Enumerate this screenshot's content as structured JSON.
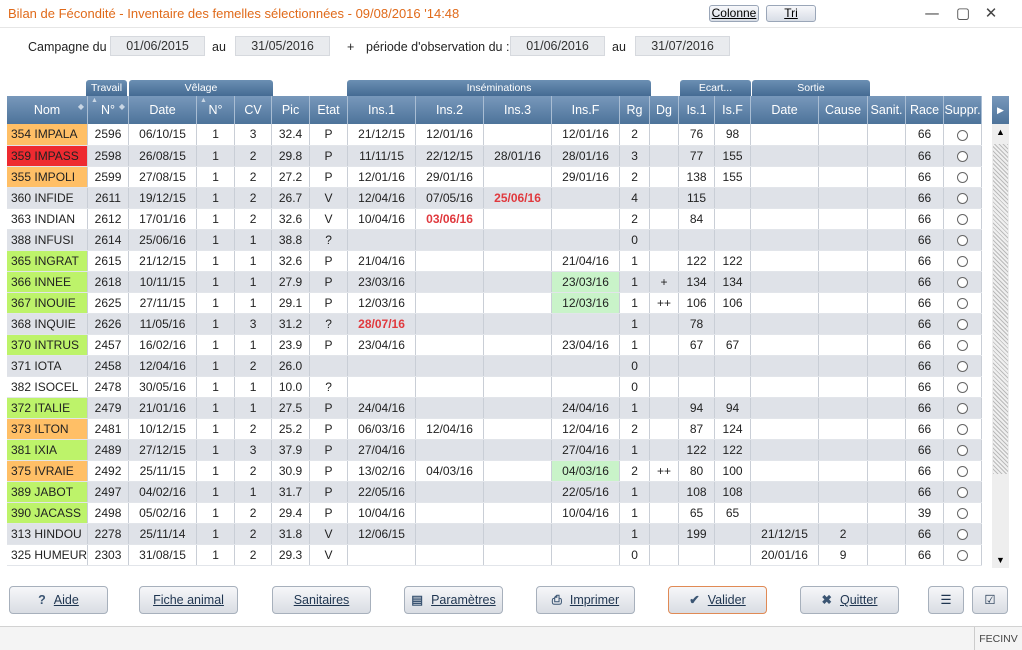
{
  "window": {
    "title": "Bilan de Fécondité - Inventaire des femelles sélectionnées - 09/08/2016 '14:48",
    "colonne_label": "Colonne",
    "tri_label": "Tri"
  },
  "campaign": {
    "label_from": "Campagne du",
    "date_from": "01/06/2015",
    "label_to": "au",
    "date_to": "31/05/2016",
    "plus": "+",
    "obs_label": "période d'observation du :",
    "obs_from": "01/06/2016",
    "obs_to_label": "au",
    "obs_to": "31/07/2016"
  },
  "groups": {
    "travail": "Travail",
    "velage": "Vêlage",
    "inseminations": "Inséminations",
    "ecart": "Ecart...",
    "sortie": "Sortie"
  },
  "columns": [
    "Nom",
    "N°",
    "Date",
    "N°",
    "CV",
    "Pic",
    "Etat",
    "Ins.1",
    "Ins.2",
    "Ins.3",
    "Ins.F",
    "Rg",
    "Dg",
    "Is.1",
    "Is.F",
    "Date",
    "Cause",
    "Sanit.",
    "Race",
    "Suppr."
  ],
  "colors": {
    "orange": "#ffbf66",
    "red": "#ee2a30",
    "green": "#bdf36a",
    "lightgreen": "#c9f3c9",
    "alert_text": "#e0393e"
  },
  "rows": [
    {
      "nom": "354 IMPALA",
      "color": "#ffbf66",
      "num": "2596",
      "date": "06/10/15",
      "vnum": "1",
      "cv": "3",
      "pic": "32.4",
      "etat": "P",
      "ins1": "21/12/15",
      "ins2": "12/01/16",
      "ins3": "",
      "insf": "12/01/16",
      "rg": "2",
      "dg": "",
      "is1": "76",
      "isf": "98",
      "sdate": "",
      "cause": "",
      "sanit": "",
      "race": "66"
    },
    {
      "nom": "359 IMPASS",
      "color": "#ee2a30",
      "num": "2598",
      "date": "26/08/15",
      "vnum": "1",
      "cv": "2",
      "pic": "29.8",
      "etat": "P",
      "ins1": "11/11/15",
      "ins2": "22/12/15",
      "ins3": "28/01/16",
      "insf": "28/01/16",
      "rg": "3",
      "dg": "",
      "is1": "77",
      "isf": "155",
      "sdate": "",
      "cause": "",
      "sanit": "",
      "race": "66"
    },
    {
      "nom": "355 IMPOLI",
      "color": "#ffbf66",
      "num": "2599",
      "date": "27/08/15",
      "vnum": "1",
      "cv": "2",
      "pic": "27.2",
      "etat": "P",
      "ins1": "12/01/16",
      "ins2": "29/01/16",
      "ins3": "",
      "insf": "29/01/16",
      "rg": "2",
      "dg": "",
      "is1": "138",
      "isf": "155",
      "sdate": "",
      "cause": "",
      "sanit": "",
      "race": "66"
    },
    {
      "nom": "360 INFIDE",
      "color": "",
      "num": "2611",
      "date": "19/12/15",
      "vnum": "1",
      "cv": "2",
      "pic": "26.7",
      "etat": "V",
      "ins1": "12/04/16",
      "ins2": "07/05/16",
      "ins3": "25/06/16",
      "ins3red": true,
      "insf": "",
      "rg": "4",
      "dg": "",
      "is1": "115",
      "isf": "",
      "sdate": "",
      "cause": "",
      "sanit": "",
      "race": "66"
    },
    {
      "nom": "363 INDIAN",
      "color": "",
      "num": "2612",
      "date": "17/01/16",
      "vnum": "1",
      "cv": "2",
      "pic": "32.6",
      "etat": "V",
      "ins1": "10/04/16",
      "ins2": "03/06/16",
      "ins2red": true,
      "ins3": "",
      "insf": "",
      "rg": "2",
      "dg": "",
      "is1": "84",
      "isf": "",
      "sdate": "",
      "cause": "",
      "sanit": "",
      "race": "66"
    },
    {
      "nom": "388 INFUSI",
      "color": "",
      "num": "2614",
      "date": "25/06/16",
      "vnum": "1",
      "cv": "1",
      "pic": "38.8",
      "etat": "?",
      "ins1": "",
      "ins2": "",
      "ins3": "",
      "insf": "",
      "rg": "0",
      "dg": "",
      "is1": "",
      "isf": "",
      "sdate": "",
      "cause": "",
      "sanit": "",
      "race": "66"
    },
    {
      "nom": "365 INGRAT",
      "color": "#bdf36a",
      "num": "2615",
      "date": "21/12/15",
      "vnum": "1",
      "cv": "1",
      "pic": "32.6",
      "etat": "P",
      "ins1": "21/04/16",
      "ins2": "",
      "ins3": "",
      "insf": "21/04/16",
      "rg": "1",
      "dg": "",
      "is1": "122",
      "isf": "122",
      "sdate": "",
      "cause": "",
      "sanit": "",
      "race": "66"
    },
    {
      "nom": "366 INNEE",
      "color": "#bdf36a",
      "num": "2618",
      "date": "10/11/15",
      "vnum": "1",
      "cv": "1",
      "pic": "27.9",
      "etat": "P",
      "ins1": "23/03/16",
      "ins2": "",
      "ins3": "",
      "insf": "23/03/16",
      "insfgreen": true,
      "rg": "1",
      "dg": "+",
      "is1": "134",
      "isf": "134",
      "sdate": "",
      "cause": "",
      "sanit": "",
      "race": "66"
    },
    {
      "nom": "367 INOUIE",
      "color": "#bdf36a",
      "num": "2625",
      "date": "27/11/15",
      "vnum": "1",
      "cv": "1",
      "pic": "29.1",
      "etat": "P",
      "ins1": "12/03/16",
      "ins2": "",
      "ins3": "",
      "insf": "12/03/16",
      "insfgreen": true,
      "rg": "1",
      "dg": "++",
      "is1": "106",
      "isf": "106",
      "sdate": "",
      "cause": "",
      "sanit": "",
      "race": "66"
    },
    {
      "nom": "368 INQUIE",
      "color": "",
      "num": "2626",
      "date": "11/05/16",
      "vnum": "1",
      "cv": "3",
      "pic": "31.2",
      "etat": "?",
      "ins1": "28/07/16",
      "ins1red": true,
      "ins2": "",
      "ins3": "",
      "insf": "",
      "rg": "1",
      "dg": "",
      "is1": "78",
      "isf": "",
      "sdate": "",
      "cause": "",
      "sanit": "",
      "race": "66"
    },
    {
      "nom": "370 INTRUS",
      "color": "#bdf36a",
      "num": "2457",
      "date": "16/02/16",
      "vnum": "1",
      "cv": "1",
      "pic": "23.9",
      "etat": "P",
      "ins1": "23/04/16",
      "ins2": "",
      "ins3": "",
      "insf": "23/04/16",
      "rg": "1",
      "dg": "",
      "is1": "67",
      "isf": "67",
      "sdate": "",
      "cause": "",
      "sanit": "",
      "race": "66"
    },
    {
      "nom": "371 IOTA",
      "color": "",
      "num": "2458",
      "date": "12/04/16",
      "vnum": "1",
      "cv": "2",
      "pic": "26.0",
      "etat": "",
      "ins1": "",
      "ins2": "",
      "ins3": "",
      "insf": "",
      "rg": "0",
      "dg": "",
      "is1": "",
      "isf": "",
      "sdate": "",
      "cause": "",
      "sanit": "",
      "race": "66"
    },
    {
      "nom": "382 ISOCEL",
      "color": "",
      "num": "2478",
      "date": "30/05/16",
      "vnum": "1",
      "cv": "1",
      "pic": "10.0",
      "etat": "?",
      "ins1": "",
      "ins2": "",
      "ins3": "",
      "insf": "",
      "rg": "0",
      "dg": "",
      "is1": "",
      "isf": "",
      "sdate": "",
      "cause": "",
      "sanit": "",
      "race": "66"
    },
    {
      "nom": "372 ITALIE",
      "color": "#bdf36a",
      "num": "2479",
      "date": "21/01/16",
      "vnum": "1",
      "cv": "1",
      "pic": "27.5",
      "etat": "P",
      "ins1": "24/04/16",
      "ins2": "",
      "ins3": "",
      "insf": "24/04/16",
      "rg": "1",
      "dg": "",
      "is1": "94",
      "isf": "94",
      "sdate": "",
      "cause": "",
      "sanit": "",
      "race": "66"
    },
    {
      "nom": "373 ILTON",
      "color": "#ffbf66",
      "num": "2481",
      "date": "10/12/15",
      "vnum": "1",
      "cv": "2",
      "pic": "25.2",
      "etat": "P",
      "ins1": "06/03/16",
      "ins2": "12/04/16",
      "ins3": "",
      "insf": "12/04/16",
      "rg": "2",
      "dg": "",
      "is1": "87",
      "isf": "124",
      "sdate": "",
      "cause": "",
      "sanit": "",
      "race": "66"
    },
    {
      "nom": "381 IXIA",
      "color": "#bdf36a",
      "num": "2489",
      "date": "27/12/15",
      "vnum": "1",
      "cv": "3",
      "pic": "37.9",
      "etat": "P",
      "ins1": "27/04/16",
      "ins2": "",
      "ins3": "",
      "insf": "27/04/16",
      "rg": "1",
      "dg": "",
      "is1": "122",
      "isf": "122",
      "sdate": "",
      "cause": "",
      "sanit": "",
      "race": "66"
    },
    {
      "nom": "375 IVRAIE",
      "color": "#ffbf66",
      "num": "2492",
      "date": "25/11/15",
      "vnum": "1",
      "cv": "2",
      "pic": "30.9",
      "etat": "P",
      "ins1": "13/02/16",
      "ins2": "04/03/16",
      "ins3": "",
      "insf": "04/03/16",
      "insfgreen": true,
      "rg": "2",
      "dg": "++",
      "is1": "80",
      "isf": "100",
      "sdate": "",
      "cause": "",
      "sanit": "",
      "race": "66"
    },
    {
      "nom": "389 JABOT",
      "color": "#bdf36a",
      "num": "2497",
      "date": "04/02/16",
      "vnum": "1",
      "cv": "1",
      "pic": "31.7",
      "etat": "P",
      "ins1": "22/05/16",
      "ins2": "",
      "ins3": "",
      "insf": "22/05/16",
      "rg": "1",
      "dg": "",
      "is1": "108",
      "isf": "108",
      "sdate": "",
      "cause": "",
      "sanit": "",
      "race": "66"
    },
    {
      "nom": "390 JACASS",
      "color": "#bdf36a",
      "num": "2498",
      "date": "05/02/16",
      "vnum": "1",
      "cv": "2",
      "pic": "29.4",
      "etat": "P",
      "ins1": "10/04/16",
      "ins2": "",
      "ins3": "",
      "insf": "10/04/16",
      "rg": "1",
      "dg": "",
      "is1": "65",
      "isf": "65",
      "sdate": "",
      "cause": "",
      "sanit": "",
      "race": "39"
    },
    {
      "nom": "313 HINDOU",
      "color": "",
      "num": "2278",
      "date": "25/11/14",
      "vnum": "1",
      "cv": "2",
      "pic": "31.8",
      "etat": "V",
      "ins1": "12/06/15",
      "ins2": "",
      "ins3": "",
      "insf": "",
      "rg": "1",
      "dg": "",
      "is1": "199",
      "isf": "",
      "sdate": "21/12/15",
      "cause": "2",
      "sanit": "",
      "race": "66"
    },
    {
      "nom": "325 HUMEUR",
      "color": "",
      "num": "2303",
      "date": "31/08/15",
      "vnum": "1",
      "cv": "2",
      "pic": "29.3",
      "etat": "V",
      "ins1": "",
      "ins2": "",
      "ins3": "",
      "insf": "",
      "rg": "0",
      "dg": "",
      "is1": "",
      "isf": "",
      "sdate": "20/01/16",
      "cause": "9",
      "sanit": "",
      "race": "66"
    }
  ],
  "buttons": {
    "aide": "Aide",
    "fiche": "Fiche animal",
    "sanitaires": "Sanitaires",
    "parametres": "Paramètres",
    "imprimer": "Imprimer",
    "valider": "Valider",
    "quitter": "Quitter"
  },
  "status": {
    "code": "FECINV"
  }
}
